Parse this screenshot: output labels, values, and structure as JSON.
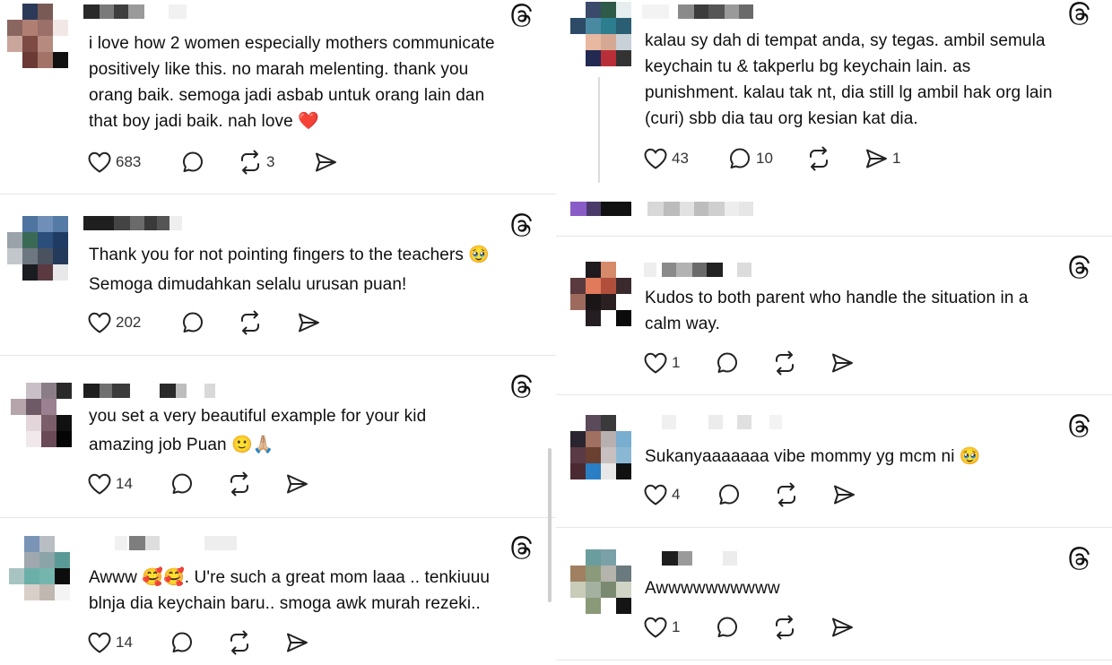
{
  "icons": {
    "like": "heart-icon",
    "reply": "reply-bubble-icon",
    "repost": "repost-icon",
    "share": "send-icon",
    "threads": "threads-logo-icon"
  },
  "left_posts": [
    {
      "lines": [
        "i love how 2 women especially mothers communicate",
        "positively like this. no marah melenting. thank you",
        "orang baik. semoga jadi asbab untuk orang lain dan",
        "that boy jadi baik. nah love ❤️"
      ],
      "likes": "683",
      "replies": "",
      "reposts": "3",
      "shares": ""
    },
    {
      "lines": [
        "Thank you for not pointing fingers to the teachers 🥹",
        "Semoga dimudahkan selalu urusan puan!"
      ],
      "likes": "202",
      "replies": "",
      "reposts": "",
      "shares": ""
    },
    {
      "lines": [
        "you set a very beautiful example for your kid",
        "amazing job Puan 🙂🙏🏼"
      ],
      "likes": "14",
      "replies": "",
      "reposts": "",
      "shares": ""
    },
    {
      "lines": [
        "Awww 🥰🥰. U're such a great mom laaa .. tenkiuuu",
        "blnja dia keychain baru.. smoga awk murah rezeki.."
      ],
      "likes": "14",
      "replies": "",
      "reposts": "",
      "shares": ""
    }
  ],
  "right_posts": [
    {
      "lines": [
        "kalau sy dah di tempat anda, sy tegas. ambil semula",
        "keychain tu & takperlu bg keychain lain. as",
        "punishment. kalau tak nt, dia still lg ambil hak org lain",
        "(curi) sbb dia tau org kesian kat dia."
      ],
      "likes": "43",
      "replies": "10",
      "reposts": "",
      "shares": "1"
    },
    {
      "lines": [
        "Kudos to both parent who handle the situation in a",
        "calm way."
      ],
      "likes": "1",
      "replies": "",
      "reposts": "",
      "shares": ""
    },
    {
      "lines": [
        "Sukanyaaaaaaa vibe mommy yg mcm ni 🥹"
      ],
      "likes": "4",
      "replies": "",
      "reposts": "",
      "shares": ""
    },
    {
      "lines": [
        "Awwwwwwwwww"
      ],
      "likes": "1",
      "replies": "",
      "reposts": "",
      "shares": ""
    }
  ]
}
